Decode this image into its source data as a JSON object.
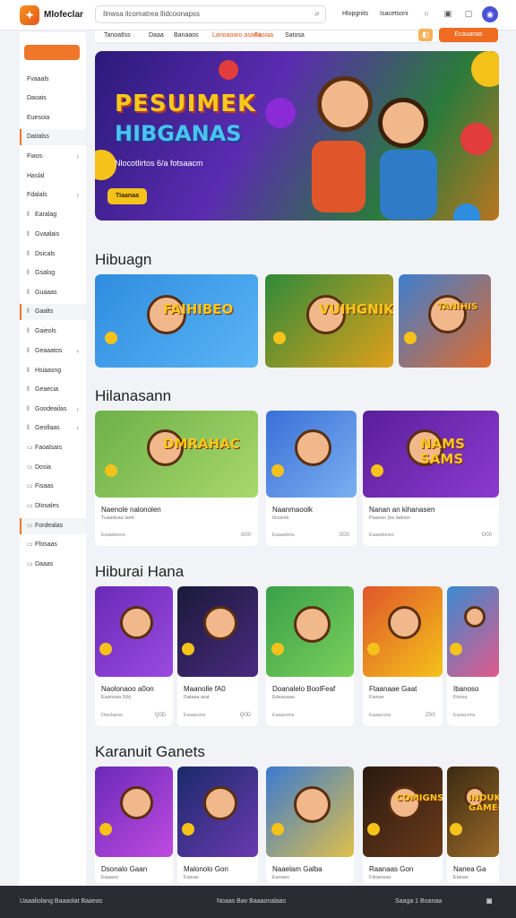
{
  "topbar": {
    "brand": "Mlofeclar",
    "search_placeholder": "Ilnwsa ilcomatrea llidcoonapss",
    "link1": "Hlopgnits",
    "link2": "Isacetsoni"
  },
  "sidebar": {
    "items": [
      {
        "label": "Fvaaals",
        "chev": false,
        "icon": ""
      },
      {
        "label": "Daoais",
        "chev": false,
        "icon": ""
      },
      {
        "label": "Euesoia",
        "chev": false,
        "icon": ""
      },
      {
        "label": "Daitalss",
        "chev": false,
        "icon": "",
        "active": true
      },
      {
        "label": "Fiaos",
        "chev": true,
        "icon": ""
      },
      {
        "label": "Haslal",
        "chev": false,
        "icon": ""
      },
      {
        "label": "Fdalals",
        "chev": true,
        "icon": ""
      },
      {
        "label": "Earalag",
        "chev": false,
        "icon": "ǁ"
      },
      {
        "label": "Gvaalais",
        "chev": false,
        "icon": "ǁ"
      },
      {
        "label": "Dsicals",
        "chev": false,
        "icon": "ǁ"
      },
      {
        "label": "Gsalog",
        "chev": false,
        "icon": "ǁ"
      },
      {
        "label": "Guaaas",
        "chev": false,
        "icon": "ǁ"
      },
      {
        "label": "Gaalts",
        "chev": false,
        "icon": "ǁ",
        "active": true
      },
      {
        "label": "Gaieols",
        "chev": false,
        "icon": "ǁ"
      },
      {
        "label": "Geaaatos",
        "chev": true,
        "icon": "ǁ"
      },
      {
        "label": "Hsiaasng",
        "chev": false,
        "icon": "ǁ"
      },
      {
        "label": "Geaecia",
        "chev": false,
        "icon": "ǁ"
      },
      {
        "label": "Goodeailas",
        "chev": true,
        "icon": "ǁ"
      },
      {
        "label": "Geollaas",
        "chev": true,
        "icon": "ǁ"
      },
      {
        "label": "Faoalsais",
        "chev": false,
        "icon": "▭"
      },
      {
        "label": "Dosia",
        "chev": false,
        "icon": "▭"
      },
      {
        "label": "Fisaas",
        "chev": false,
        "icon": "▭"
      },
      {
        "label": "Dlosales",
        "chev": false,
        "icon": "▭"
      },
      {
        "label": "Fordealas",
        "chev": false,
        "icon": "▭",
        "active": true
      },
      {
        "label": "Ffosaas",
        "chev": false,
        "icon": "▭"
      },
      {
        "label": "Daaas",
        "chev": false,
        "icon": "▭"
      }
    ]
  },
  "filters": {
    "chips": [
      "Tanoatlss",
      "Daaa",
      "Banaaos",
      "Lanoaoaro asaoa",
      "Fasiaa",
      "Satosa"
    ],
    "join_label": "Ecauanas"
  },
  "hero": {
    "title1": "PESUIMEK",
    "title2": "HIBGANAS",
    "subtitle": "Nlocotlirtos 6/a fotsaacm",
    "button": "Tiaanaa"
  },
  "sections": [
    {
      "title": "Hibuagn",
      "cards": [
        {
          "art": "FAIHIBEO"
        },
        {
          "art": "VUIHGNIK"
        },
        {
          "art": "TANIHIS"
        }
      ]
    },
    {
      "title": "Hilanasann",
      "cards": [
        {
          "art": "DMRAHAC",
          "title": "Naenole nalonolen",
          "sub": "Tuaadoaa Iamt",
          "meta": "Eaaalwons",
          "rating": "G00"
        },
        {
          "art": "",
          "title": "Naanmaoolk",
          "sub": "Ilcosols",
          "meta": "Eaaadons",
          "rating": "0O0"
        },
        {
          "art": "NAMS SAMS",
          "title": "Nanan an kihanasen",
          "sub": "Paaooo (bs ladosn",
          "meta": "Eaaadones",
          "rating": "O00"
        }
      ]
    },
    {
      "title": "Hiburai Hana",
      "cards": [
        {
          "art": "",
          "title": "Naolonaoo a0on",
          "sub": "Eaanoaa 0(b)",
          "meta": "Dieclaess",
          "rating": "Q0D"
        },
        {
          "art": "",
          "title": "Maanolle fA0",
          "sub": "Dalaaa arat",
          "meta": "Eaaacons",
          "rating": "Q0D"
        },
        {
          "art": "",
          "title": "Doanalelo BoolFeaf",
          "sub": "Edeaoaao",
          "meta": "Eaaacons",
          "rating": "",
          "badge": true
        },
        {
          "art": "",
          "title": "Ftaanaae Gaat",
          "sub": "Fianse",
          "meta": "Eaaacons",
          "rating": "Z9S"
        },
        {
          "art": "",
          "title": "Ibanoso",
          "sub": "Fiorsa",
          "meta": "Eaaacons",
          "rating": ""
        }
      ]
    },
    {
      "title": "Karanuit Ganets",
      "cards": [
        {
          "art": "",
          "title": "Dsonalo Gaan",
          "sub": "Eaaaoo",
          "meta": "",
          "rating": ""
        },
        {
          "art": "",
          "title": "Malonolo Gon",
          "sub": "Fianas",
          "meta": "",
          "rating": ""
        },
        {
          "art": "",
          "title": "Naaelam Galba",
          "sub": "Eanaeo",
          "meta": "",
          "rating": ""
        },
        {
          "art": "COMIGNS",
          "title": "Raanaas Gon",
          "sub": "Fdoaneas",
          "meta": "",
          "rating": ""
        },
        {
          "art": "INDUK GAMEG",
          "title": "Nanea Ga",
          "sub": "Eianas",
          "meta": "",
          "rating": ""
        }
      ]
    }
  ],
  "footer": {
    "left": "Uaaaliolang Baaaolat Baaeas",
    "center": "Noaas Bav Baaaonalaas",
    "right": "Saaga 1 Boanaa"
  },
  "colors": {
    "accent": "#ef6c22",
    "sidebar_bg": "#ffffff",
    "page_bg": "#f2f3f6",
    "footer_bg": "#2a2c33"
  }
}
